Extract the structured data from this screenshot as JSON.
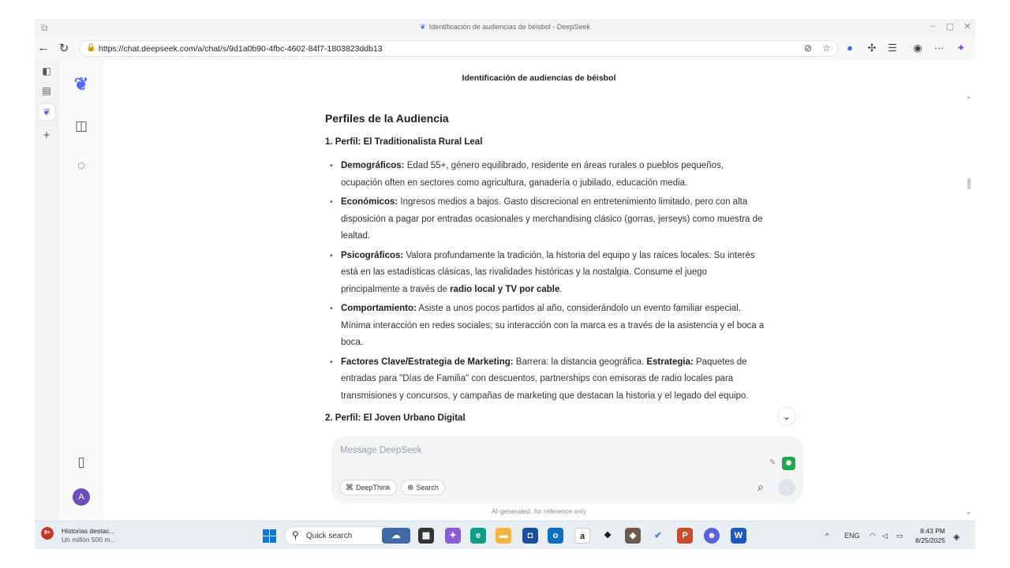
{
  "window": {
    "title": "Identificación de audiencias de béisbol - DeepSeek",
    "controls": {
      "minimize": "–",
      "maximize": "▢",
      "close": "✕"
    }
  },
  "browser": {
    "url": "https://chat.deepseek.com/a/chat/s/9d1a0b90-4fbc-4602-84f7-1803823ddb13"
  },
  "chat": {
    "title": "Identificación de audiencias de béisbol",
    "heading": "Perfiles de la Audiencia",
    "profile1_title": "1. Perfil: El Traditionalista Rural Leal",
    "items": [
      {
        "label": "Demográficos:",
        "text": " Edad 55+, género equilibrado, residente en áreas rurales o pueblos pequeños, ocupación often en sectores como agricultura, ganadería o jubilado, educación media."
      },
      {
        "label": "Económicos:",
        "text": " Ingresos medios a bajos. Gasto discrecional en entretenimiento limitado, pero con alta disposición a pagar por entradas ocasionales y merchandising clásico (gorras, jerseys) como muestra de lealtad."
      },
      {
        "label": "Psicográficos:",
        "text": " Valora profundamente la tradición, la historia del equipo y las raíces locales. Su interés está en las estadísticas clásicas, las rivalidades históricas y la nostalgia. Consume el juego principalmente a través de ",
        "strong": "radio local y TV por cable",
        "tail": "."
      },
      {
        "label": "Comportamiento:",
        "text": " Asiste a unos pocos partidos al año, considerándolo un evento familiar especial. Mínima interacción en redes sociales; su interacción con la marca es a través de la asistencia y el boca a boca."
      },
      {
        "label": "Factores Clave/Estrategia de Marketing:",
        "text": " Barrera: la distancia geográfica. ",
        "strong": "Estrategia:",
        "tail": " Paquetes de entradas para \"Días de Familia\" con descuentos, partnerships con emisoras de radio locales para transmisiones y concursos, y campañas de marketing que destacan la historia y el legado del equipo."
      }
    ],
    "profile2_title": "2. Perfil: El Joven Urbano Digital"
  },
  "composer": {
    "placeholder": "Message DeepSeek",
    "deepthink_label": "DeepThink",
    "search_label": "Search",
    "disclaimer": "AI-generated, for reference only"
  },
  "user": {
    "avatar_initial": "A"
  },
  "taskbar": {
    "news_badge": "9+",
    "news_title": "Historias destac...",
    "news_sub": "Un millón 500 m...",
    "search_label": "Quick search",
    "lang": "ENG",
    "time": "8:43 PM",
    "date": "8/25/2025"
  },
  "colors": {
    "accent": "#4d6bfe",
    "avatar": "#6b4fbb",
    "windows_blue": "#0a78d4"
  }
}
